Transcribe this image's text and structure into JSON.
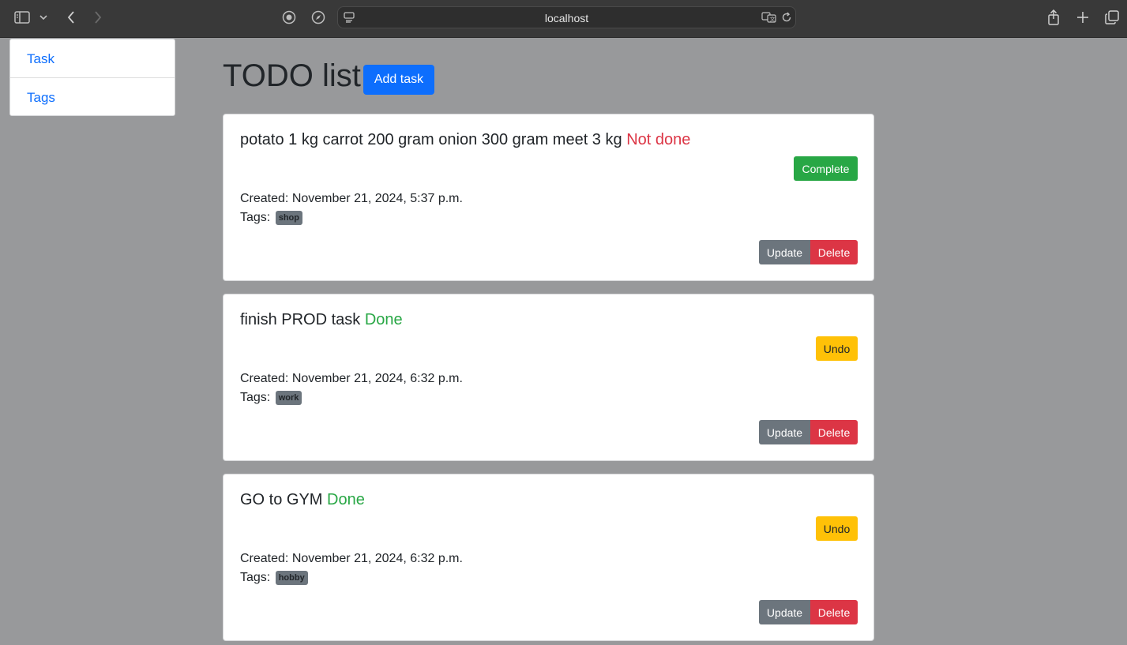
{
  "browser": {
    "url": "localhost"
  },
  "nav": {
    "items": [
      {
        "label": "Task"
      },
      {
        "label": "Tags"
      }
    ]
  },
  "page": {
    "title": "TODO list",
    "add_button": "Add task"
  },
  "tasks": [
    {
      "title": "potato 1 kg carrot 200 gram onion 300 gram meet 3 kg",
      "status": "Not done",
      "toggle_label": "Complete",
      "created": "Created: November 21, 2024, 5:37 p.m.",
      "tags_label": "Tags:",
      "tag": "shop",
      "update_label": "Update",
      "delete_label": "Delete"
    },
    {
      "title": "finish PROD task",
      "status": "Done",
      "toggle_label": "Undo",
      "created": "Created: November 21, 2024, 6:32 p.m.",
      "tags_label": "Tags:",
      "tag": "work",
      "update_label": "Update",
      "delete_label": "Delete"
    },
    {
      "title": "GO to GYM",
      "status": "Done",
      "toggle_label": "Undo",
      "created": "Created: November 21, 2024, 6:32 p.m.",
      "tags_label": "Tags:",
      "tag": "hobby",
      "update_label": "Update",
      "delete_label": "Delete"
    }
  ],
  "colors": {
    "primary": "#0d6efd",
    "success": "#28a745",
    "danger": "#dc3545",
    "warning": "#ffc107",
    "secondary": "#6c757d"
  }
}
